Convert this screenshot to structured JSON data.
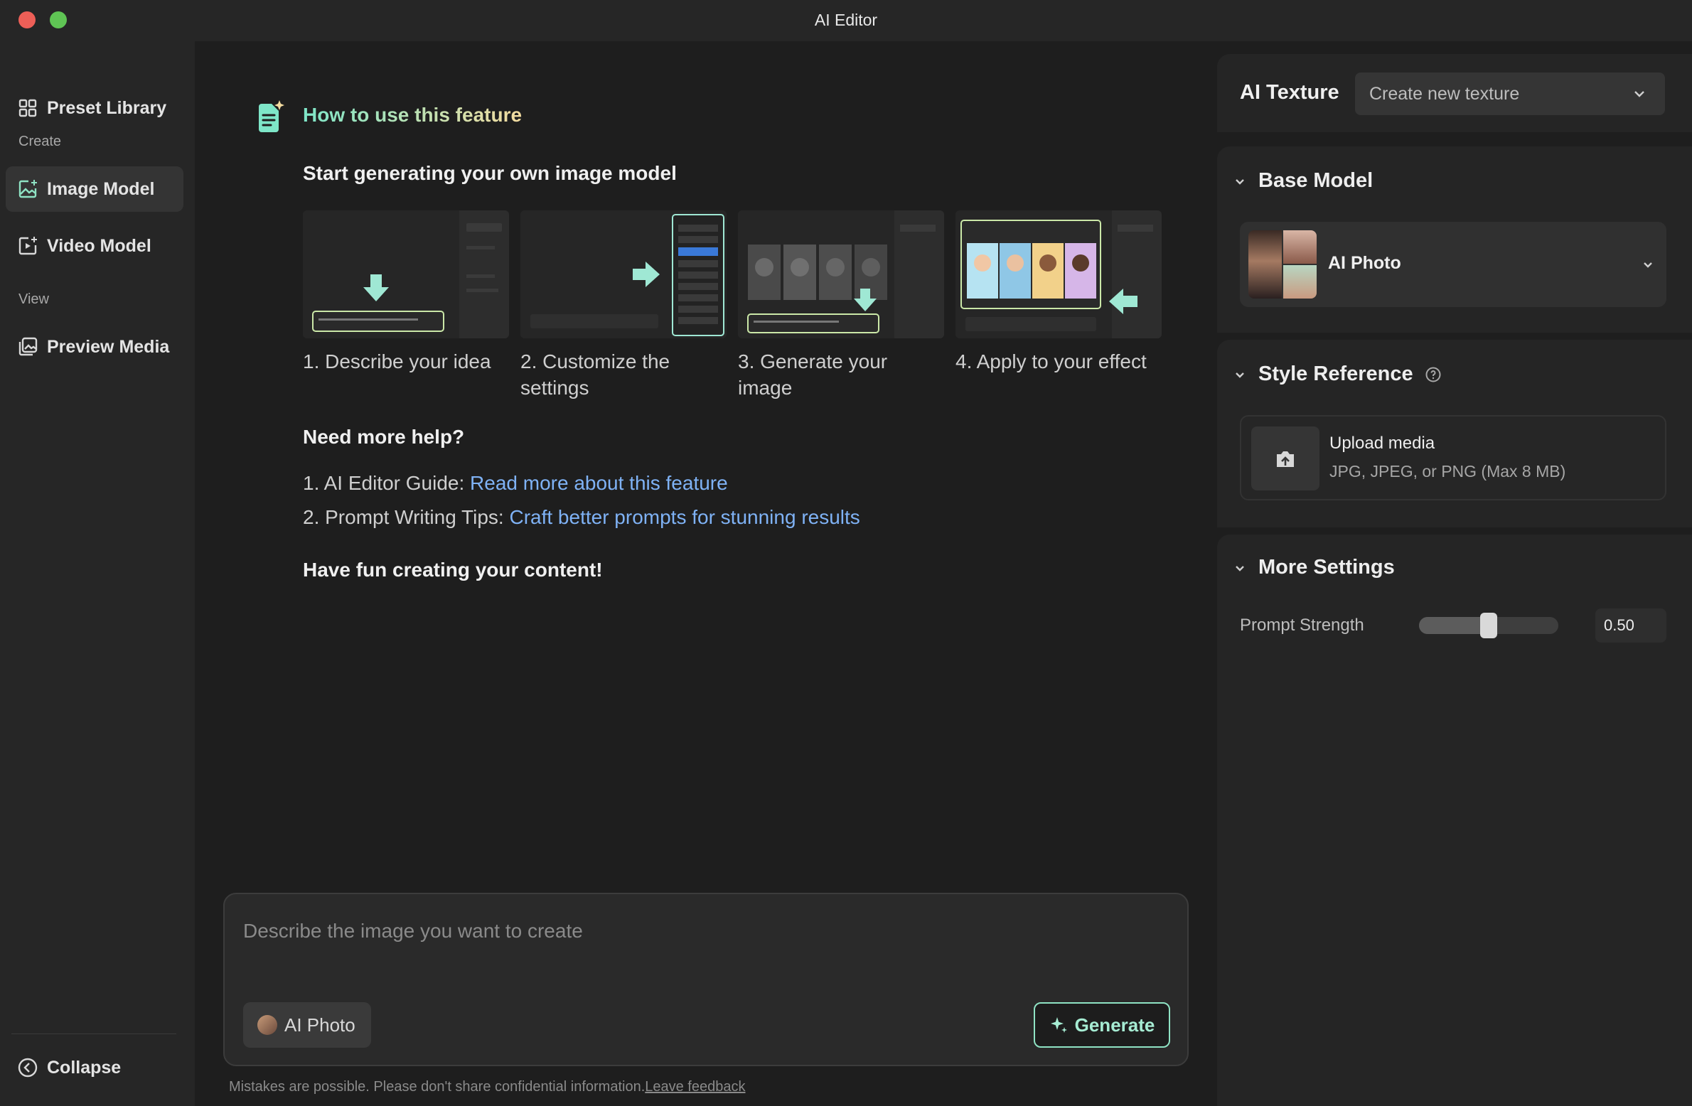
{
  "window": {
    "title": "AI Editor"
  },
  "sidebar": {
    "preset_library": "Preset Library",
    "create_label": "Create",
    "image_model": "Image Model",
    "video_model": "Video Model",
    "view_label": "View",
    "preview_media": "Preview Media",
    "collapse": "Collapse"
  },
  "main": {
    "howto_title": "How to use this feature",
    "sub_heading": "Start generating your own image model",
    "steps": [
      {
        "label": "1. Describe your idea"
      },
      {
        "label": "2. Customize the settings"
      },
      {
        "label": "3. Generate your image"
      },
      {
        "label": "4. Apply to your effect"
      }
    ],
    "help_heading": "Need more help?",
    "help_1_prefix": "1. AI Editor Guide: ",
    "help_1_link": "Read more about this feature",
    "help_2_prefix": "2. Prompt Writing Tips: ",
    "help_2_link": "Craft better prompts for stunning results",
    "fun_text": "Have fun creating your content!"
  },
  "prompt": {
    "placeholder": "Describe the image you want to create",
    "model_chip": "AI Photo",
    "generate_label": "Generate",
    "disclaimer": "Mistakes are possible. Please don't share confidential information.",
    "feedback_link": "Leave feedback"
  },
  "right_panel": {
    "texture_label": "AI Texture",
    "texture_select": "Create new texture",
    "base_model_heading": "Base Model",
    "base_model_name": "AI Photo",
    "style_reference_heading": "Style Reference",
    "upload_title": "Upload media",
    "upload_sub": "JPG, JPEG, or PNG (Max 8 MB)",
    "more_settings_heading": "More Settings",
    "prompt_strength_label": "Prompt Strength",
    "prompt_strength_value": "0.50",
    "prompt_strength": 0.5
  },
  "colors": {
    "accent_green": "#8fe3c4",
    "link_blue": "#7fb2f5",
    "close_red": "#ed5f57",
    "zoom_green": "#5fc454"
  }
}
